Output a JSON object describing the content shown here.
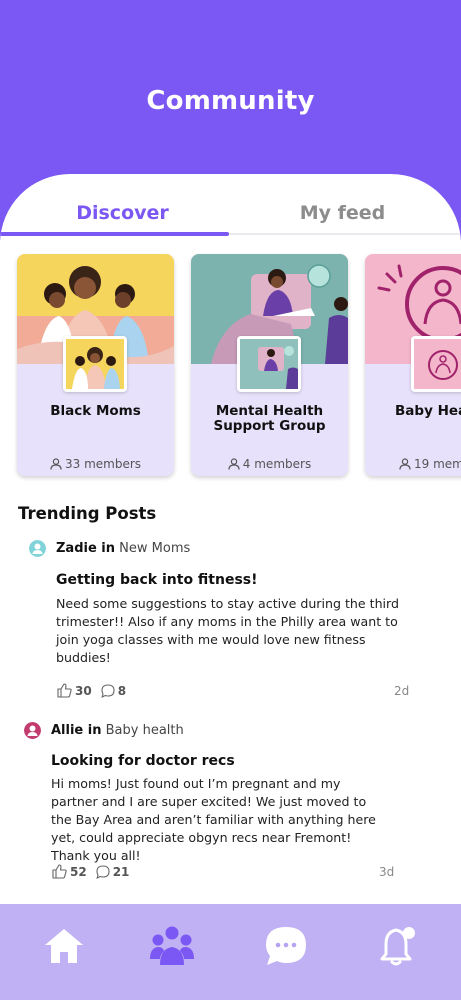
{
  "header": {
    "title": "Community"
  },
  "tabs": [
    {
      "label": "Discover",
      "active": true
    },
    {
      "label": "My feed",
      "active": false
    }
  ],
  "communities": [
    {
      "name": "Black Moms",
      "members": "33 members"
    },
    {
      "name": "Mental Health Support Group",
      "members": "4 members"
    },
    {
      "name": "Baby Hea",
      "members": "19 mem"
    }
  ],
  "trending": {
    "title": "Trending Posts",
    "posts": [
      {
        "author": "Zadie in",
        "group": "New Moms",
        "title": "Getting back into fitness!",
        "body": "Need some suggestions to stay active during the third trimester!! Also if any moms in the Philly area want to join yoga classes with me would love new fitness buddies!",
        "likes": "30",
        "comments": "8",
        "time": "2d",
        "avatar_color": "#7fd3d9"
      },
      {
        "author": "Allie in",
        "group": "Baby health",
        "title": "Looking for doctor recs",
        "body": "Hi moms! Just found out I’m pregnant and my partner and I are super excited! We just moved to the Bay Area and aren’t familiar with anything here yet, could appreciate obgyn recs near Fremont! Thank you all!",
        "likes": "52",
        "comments": "21",
        "time": "3d",
        "avatar_color": "#c23b6e"
      }
    ]
  },
  "nav": {
    "items": [
      {
        "icon": "home-icon"
      },
      {
        "icon": "community-icon",
        "active": true
      },
      {
        "icon": "chat-icon"
      },
      {
        "icon": "bell-icon"
      }
    ]
  },
  "colors": {
    "accent": "#7b57f3",
    "nav_bg": "#c0b0f4",
    "card_bg": "#e7e1fb"
  }
}
